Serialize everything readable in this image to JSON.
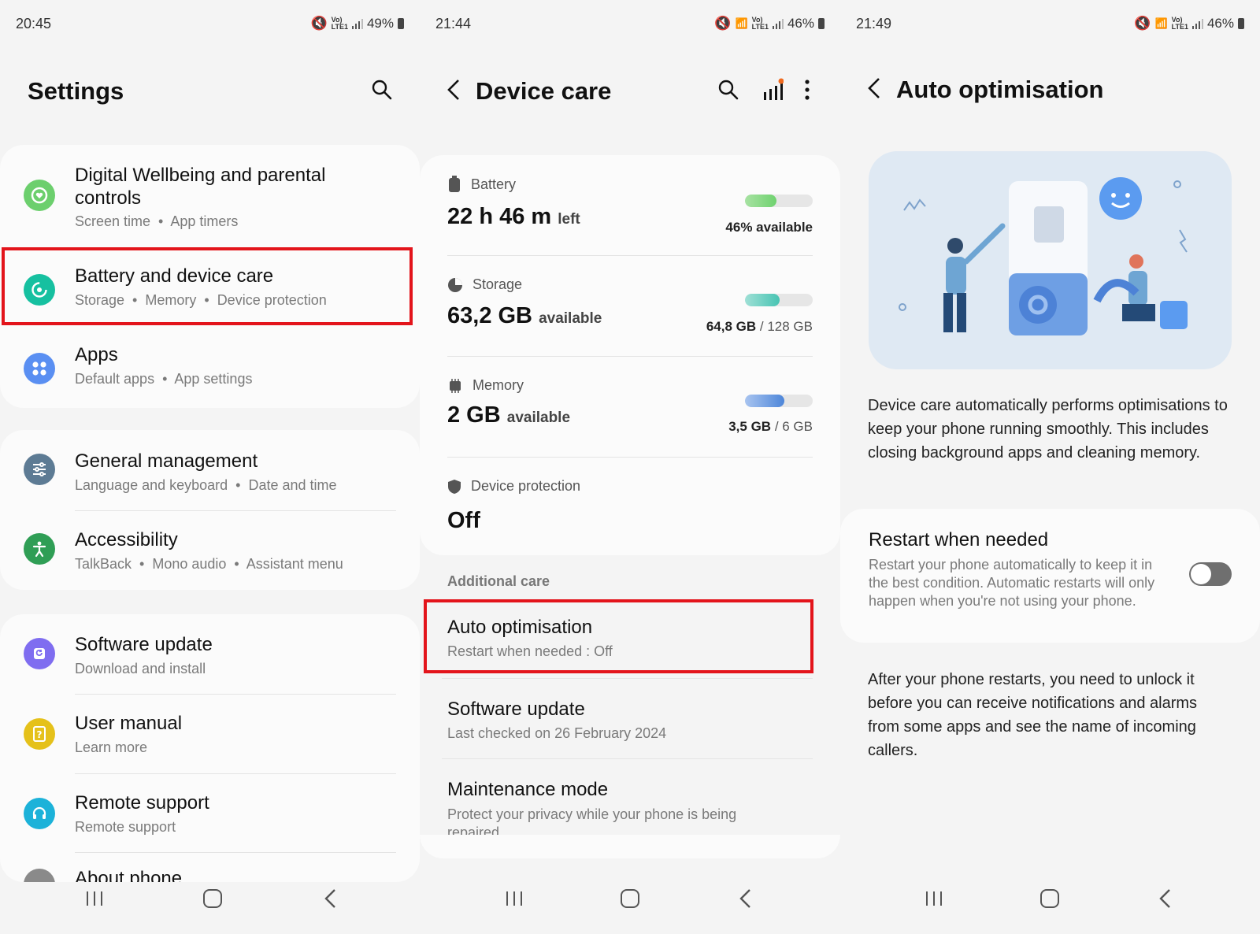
{
  "colors": {
    "highlight": "#e3141b",
    "wellbeing": "#6ccf6d",
    "battery": "#16c0a0",
    "apps": "#5a8ff2",
    "general": "#5d7b94",
    "accessibility": "#2f9e55",
    "software": "#7f6df0",
    "manual": "#e5c11a",
    "remote": "#1cb2d9"
  },
  "screen1": {
    "status": {
      "time": "20:45",
      "battery": "49%",
      "volte": "Vo)\nLTE1"
    },
    "title": "Settings",
    "items": [
      {
        "title": "Digital Wellbeing and parental controls",
        "subs": [
          "Screen time",
          "App timers"
        ],
        "icon": "wellbeing-icon"
      },
      {
        "title": "Battery and device care",
        "subs": [
          "Storage",
          "Memory",
          "Device protection"
        ],
        "icon": "battery-care-icon"
      },
      {
        "title": "Apps",
        "subs": [
          "Default apps",
          "App settings"
        ],
        "icon": "apps-icon"
      },
      {
        "title": "General management",
        "subs": [
          "Language and keyboard",
          "Date and time"
        ],
        "icon": "sliders-icon"
      },
      {
        "title": "Accessibility",
        "subs": [
          "TalkBack",
          "Mono audio",
          "Assistant menu"
        ],
        "icon": "accessibility-icon"
      },
      {
        "title": "Software update",
        "subs": [
          "Download and install"
        ],
        "icon": "software-update-icon"
      },
      {
        "title": "User manual",
        "subs": [
          "Learn more"
        ],
        "icon": "user-manual-icon"
      },
      {
        "title": "Remote support",
        "subs": [
          "Remote support"
        ],
        "icon": "headset-icon"
      },
      {
        "title": "About phone",
        "subs": [],
        "icon": "phone-icon"
      }
    ]
  },
  "screen2": {
    "status": {
      "time": "21:44",
      "battery": "46%"
    },
    "title": "Device care",
    "battery": {
      "label": "Battery",
      "value": "22 h 46 m",
      "unit": "left",
      "right": "46% available",
      "fill": 0.46
    },
    "storage": {
      "label": "Storage",
      "value": "63,2 GB",
      "unit": "available",
      "used": "64,8 GB",
      "total": "/ 128 GB",
      "fill": 0.51
    },
    "memory": {
      "label": "Memory",
      "value": "2 GB",
      "unit": "available",
      "used": "3,5 GB",
      "total": "/ 6 GB",
      "fill": 0.58
    },
    "protection": {
      "label": "Device protection",
      "value": "Off"
    },
    "additional_label": "Additional care",
    "items": [
      {
        "title": "Auto optimisation",
        "sub": "Restart when needed : Off"
      },
      {
        "title": "Software update",
        "sub": "Last checked on 26 February 2024"
      },
      {
        "title": "Maintenance mode",
        "sub": "Protect your privacy while your phone is being repaired."
      }
    ]
  },
  "screen3": {
    "status": {
      "time": "21:49",
      "battery": "46%"
    },
    "title": "Auto optimisation",
    "description": "Device care automatically performs optimisations to keep your phone running smoothly. This includes closing background apps and cleaning memory.",
    "restart": {
      "title": "Restart when needed",
      "sub": "Restart your phone automatically to keep it in the best condition. Automatic restarts will only happen when you're not using your phone.",
      "enabled": false
    },
    "note": "After your phone restarts, you need to unlock it before you can receive notifications and alarms from some apps and see the name of incoming callers."
  }
}
